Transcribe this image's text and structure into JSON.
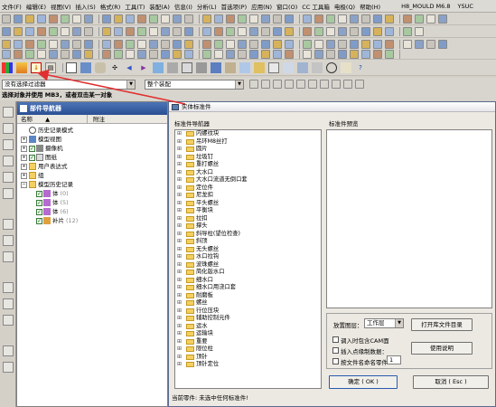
{
  "menubar": {
    "items": [
      "文件(F)",
      "编辑(E)",
      "视图(V)",
      "插入(S)",
      "格式(R)",
      "工具(T)",
      "装配(A)",
      "信息(I)",
      "分析(L)",
      "首选项(P)",
      "应用(N)",
      "窗口(O)",
      "CC 工具箱",
      "电极(Q)",
      "帮助(H)"
    ],
    "app_title": "H8_MOULD M6.8",
    "app_title_suffix": "YSUC"
  },
  "filter_row": {
    "selection_filter": "没有选择过滤器",
    "assembly_scope": "整个装配"
  },
  "status_line": "选择对象并使用 MB3，或者双击某一对象",
  "part_navigator": {
    "title": "部件导航器",
    "col_name": "名称",
    "col_note": "附注",
    "rows": [
      {
        "label": "历史记录模式"
      },
      {
        "label": "模型视图"
      },
      {
        "label": "摄像机"
      },
      {
        "label": "图纸"
      },
      {
        "label": "用户表达式"
      },
      {
        "label": "组"
      },
      {
        "label": "模型历史记录"
      },
      {
        "label": "体",
        "suffix": "(0)"
      },
      {
        "label": "体",
        "suffix": "(5)"
      },
      {
        "label": "体",
        "suffix": "(6)"
      },
      {
        "label": "补片",
        "suffix": "(12)"
      }
    ]
  },
  "dialog": {
    "title": "实体标准件",
    "nav_label": "标准件导航器",
    "preview_label": "标准件预览",
    "items": [
      "内螺纹块",
      "吊环M8丝打",
      "圆片",
      "垃圾钉",
      "重打螺丝",
      "大水口",
      "大水口流道无倒口套",
      "定位件",
      "尼龙扣",
      "平头螺丝",
      "平衡块",
      "拉扣",
      "撑头",
      "斜导柱(望位检查)",
      "斜顶",
      "无头螺丝",
      "水口拉钩",
      "波珠螺丝",
      "简化版水口",
      "细水口",
      "细水口用浇口套",
      "耐磨板",
      "螺丝",
      "行位压块",
      "辅助控制元件",
      "运水",
      "运输块",
      "重要",
      "限位柱",
      "顶针",
      "顶针定位"
    ],
    "layer_label": "放置图层：",
    "layer_value": "工作层",
    "opt_add_cam": "调入时包含CAM面",
    "opt_rename": "插入点缘制数据：",
    "opt_rename_value": "1",
    "opt_by_file": "按文件名命名零件",
    "btn_open_dir": "打开库文件目录",
    "btn_help": "使用说明",
    "btn_ok": "确定 ( OK )",
    "btn_cancel": "取消 ( Esc )"
  },
  "bottom_status": "当前零件: 未选中任何标准件!",
  "colors": {
    "arrow": "#e03030",
    "nav_header": "#2a4f94",
    "folder": "#f5d061"
  }
}
